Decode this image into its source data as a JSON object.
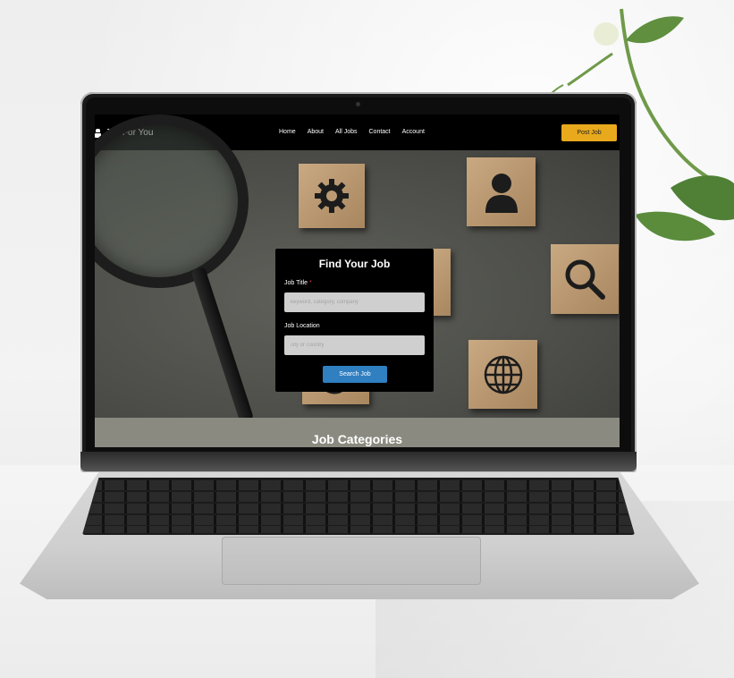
{
  "site": {
    "brand": "Jop For You",
    "nav": [
      "Home",
      "About",
      "All Jobs",
      "Contact",
      "Account"
    ],
    "post_job": "Post Job"
  },
  "search": {
    "title": "Find Your Job",
    "job_title_label": "Job Title",
    "required_marker": "*",
    "job_title_placeholder": "keyword, category, company",
    "job_location_label": "Job Location",
    "job_location_placeholder": "city or country",
    "button": "Search Job"
  },
  "categories": {
    "heading": "Job Categories"
  },
  "colors": {
    "accent": "#e8a91c",
    "button": "#2f7fc1",
    "required": "#e23b3b"
  },
  "hero_icons": [
    "gear-icon",
    "person-icon",
    "magnifier-icon",
    "target-icon",
    "globe-icon"
  ]
}
